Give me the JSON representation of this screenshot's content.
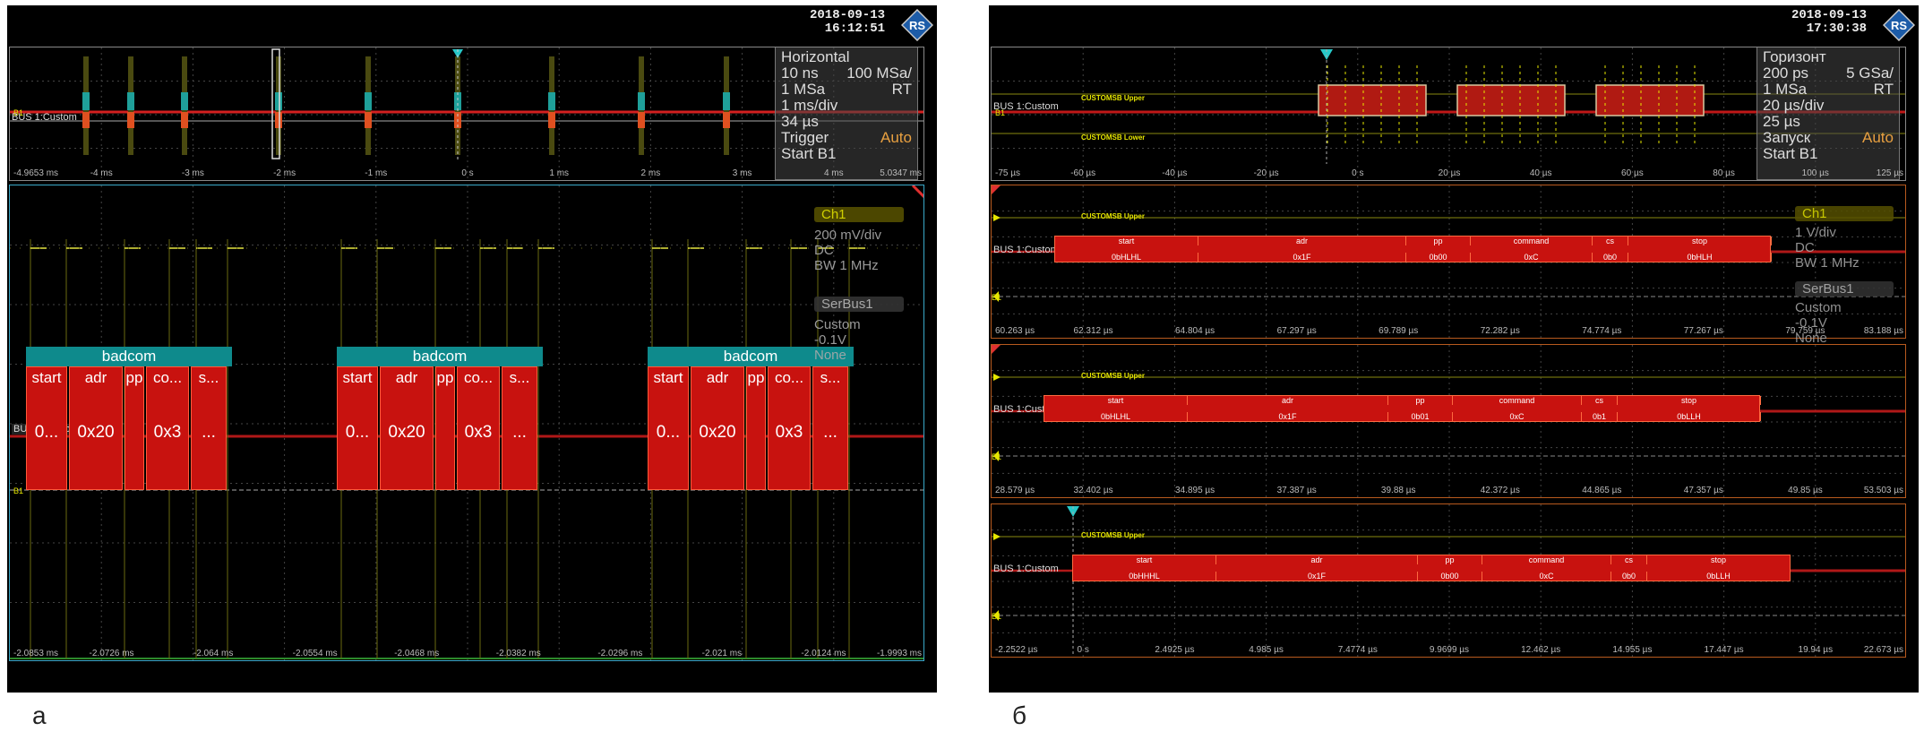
{
  "panel_a": {
    "caption": "а",
    "datetime": {
      "date": "2018-09-13",
      "time": "16:12:51"
    },
    "overview": {
      "bus_label": "BUS 1:Custom",
      "ticks": [
        "-4.9653 ms",
        "-4 ms",
        "-3 ms",
        "-2 ms",
        "-1 ms",
        "0 s",
        "1 ms",
        "2 ms",
        "3 ms",
        "4 ms",
        "5.0347 ms"
      ]
    },
    "horizontal": {
      "title": "Horizontal",
      "row1": [
        "10 ns",
        "100 MSa/"
      ],
      "row2": [
        "1 MSa",
        "RT"
      ],
      "row3": "1 ms/div",
      "row4": "34 µs",
      "trigger": "Trigger",
      "auto": "Auto",
      "start": "Start  B1"
    },
    "channel": {
      "ch1": "Ch1",
      "ch1_scale": "200 mV/div",
      "ch1_coupling": "DC",
      "ch1_bw": "BW 1 MHz",
      "serbus": "SerBus1",
      "serbus_protocol": "Custom",
      "serbus_level": "-0.1V",
      "serbus_mode": "None"
    },
    "main": {
      "bus_label": "BUS 1:Custom",
      "ticks": [
        "-2.0853 ms",
        "-2.0726 ms",
        "-2.064 ms",
        "-2.0554 ms",
        "-2.0468 ms",
        "-2.0382 ms",
        "-2.0296 ms",
        "-2.021 ms",
        "-2.0124 ms",
        "-1.9993 ms"
      ],
      "groups": [
        {
          "header": "badcom",
          "fields": [
            "start",
            "adr",
            "pp",
            "co...",
            "s..."
          ],
          "values": [
            "0...",
            "0x20",
            "",
            "0x3",
            "..."
          ]
        },
        {
          "header": "badcom",
          "fields": [
            "start",
            "adr",
            "pp",
            "co...",
            "s..."
          ],
          "values": [
            "0...",
            "0x20",
            "",
            "0x3",
            "..."
          ]
        },
        {
          "header": "badcom",
          "fields": [
            "start",
            "adr",
            "pp",
            "co...",
            "s..."
          ],
          "values": [
            "0...",
            "0x20",
            "",
            "0x3",
            "..."
          ]
        }
      ]
    }
  },
  "panel_b": {
    "caption": "б",
    "datetime": {
      "date": "2018-09-13",
      "time": "17:30:38"
    },
    "overview": {
      "bus_label": "BUS 1:Custom",
      "upper_label": "CUSTOMSB Upper",
      "lower_label": "CUSTOMSB Lower",
      "ticks": [
        "-75 µs",
        "-60 µs",
        "-40 µs",
        "-20 µs",
        "0 s",
        "20 µs",
        "40 µs",
        "60 µs",
        "80 µs",
        "100 µs",
        "125 µs"
      ]
    },
    "horizontal": {
      "title": "Горизонт",
      "row1": [
        "200 ps",
        "5 GSa/"
      ],
      "row2": [
        "1 MSa",
        "RT"
      ],
      "row3": "20 µs/div",
      "row4": "25 µs",
      "trigger": "Запуск",
      "auto": "Auto",
      "start": "Start  B1"
    },
    "channel": {
      "ch1": "Ch1",
      "ch1_scale": "1 V/div",
      "ch1_coupling": "DC",
      "ch1_bw": "BW 1 MHz",
      "serbus": "SerBus1",
      "serbus_protocol": "Custom",
      "serbus_level": "-0.1V",
      "serbus_mode": "None"
    },
    "zooms": [
      {
        "upper_label": "CUSTOMSB Upper",
        "bus_label": "BUS 1:Custom",
        "fields": [
          "start",
          "adr",
          "pp",
          "command",
          "cs",
          "stop"
        ],
        "values": [
          "0bHLHL",
          "0x1F",
          "0b00",
          "0xC",
          "0b0",
          "0bHLH"
        ],
        "ticks": [
          "60.263 µs",
          "62.312 µs",
          "64.804 µs",
          "67.297 µs",
          "69.789 µs",
          "72.282 µs",
          "74.774 µs",
          "77.267 µs",
          "79.759 µs",
          "83.188 µs"
        ]
      },
      {
        "upper_label": "CUSTOMSB Upper",
        "bus_label": "BUS 1:Custom",
        "fields": [
          "start",
          "adr",
          "pp",
          "command",
          "cs",
          "stop"
        ],
        "values": [
          "0bHLHL",
          "0x1F",
          "0b01",
          "0xC",
          "0b1",
          "0bLLH"
        ],
        "ticks": [
          "28.579 µs",
          "32.402 µs",
          "34.895 µs",
          "37.387 µs",
          "39.88 µs",
          "42.372 µs",
          "44.865 µs",
          "47.357 µs",
          "49.85 µs",
          "53.503 µs"
        ]
      },
      {
        "upper_label": "CUSTOMSB Upper",
        "bus_label": "BUS 1:Custom",
        "fields": [
          "start",
          "adr",
          "pp",
          "command",
          "cs",
          "stop"
        ],
        "values": [
          "0bHHHL",
          "0x1F",
          "0b00",
          "0xC",
          "0b0",
          "0bLLH"
        ],
        "ticks": [
          "-2.2522 µs",
          "0 s",
          "2.4925 µs",
          "4.985 µs",
          "7.4774 µs",
          "9.9699 µs",
          "12.462 µs",
          "14.955 µs",
          "17.447 µs",
          "19.94 µs",
          "22.673 µs"
        ]
      }
    ]
  }
}
